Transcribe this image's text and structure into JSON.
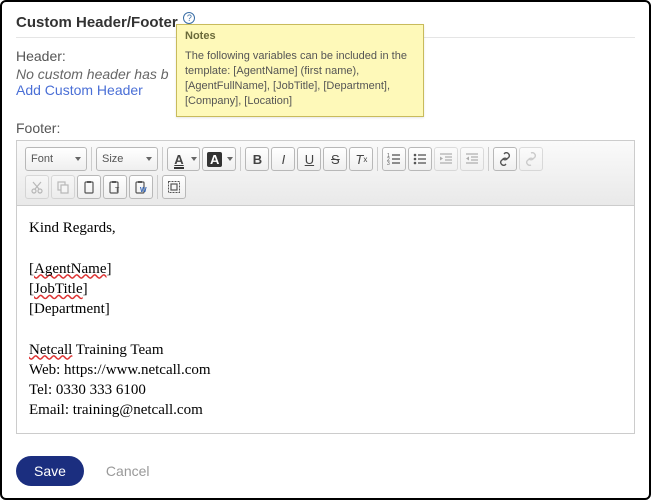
{
  "title": "Custom Header/Footer",
  "help_icon_glyph": "?",
  "tooltip": {
    "heading": "Notes",
    "body": "The following variables can be included in the template: [AgentName] (first name), [AgentFullName], [JobTitle], [Department], [Company], [Location]"
  },
  "header": {
    "label": "Header:",
    "empty_msg": "No custom header has b",
    "add_link": "Add Custom Header"
  },
  "footer": {
    "label": "Footer:"
  },
  "toolbar": {
    "font_label": "Font",
    "size_label": "Size"
  },
  "editor": {
    "line1": "Kind Regards,",
    "var1": "[AgentName]",
    "var2": "[JobTitle]",
    "var3": "[Department]",
    "team": "Netcall Training Team",
    "web": "Web: https://www.netcall.com",
    "tel": "Tel: 0330 333 6100",
    "email": "Email: training@netcall.com"
  },
  "actions": {
    "save": "Save",
    "cancel": "Cancel"
  }
}
